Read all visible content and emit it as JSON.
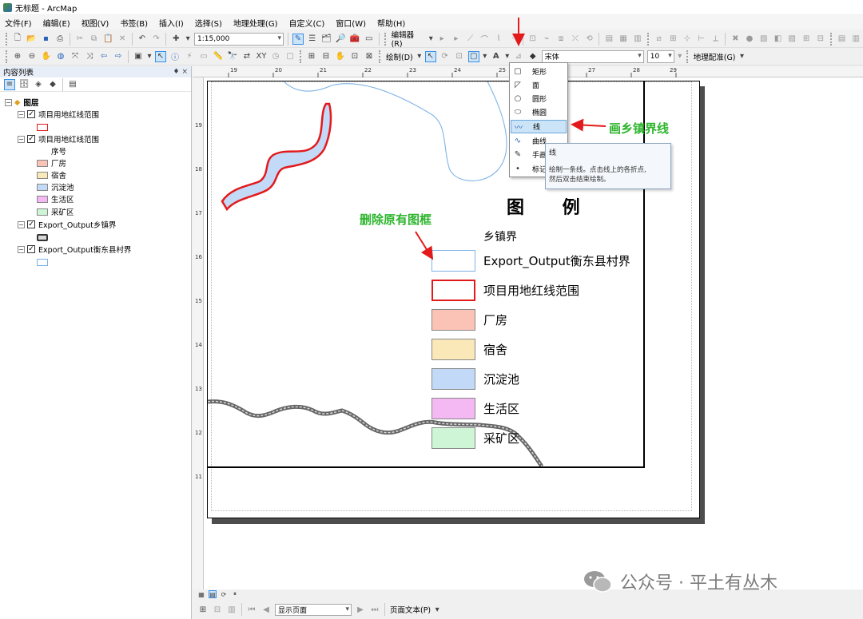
{
  "window": {
    "title": "无标题 - ArcMap"
  },
  "menu": [
    "文件(F)",
    "编辑(E)",
    "视图(V)",
    "书签(B)",
    "插入(I)",
    "选择(S)",
    "地理处理(G)",
    "自定义(C)",
    "窗口(W)",
    "帮助(H)"
  ],
  "toolbar1": {
    "scale": "1:15,000",
    "editor": "编辑器(R)"
  },
  "toolbar2": {
    "draw": "绘制(D)",
    "font": "宋体",
    "font_size": "10",
    "georef": "地理配准(G)"
  },
  "toc": {
    "title": "内容列表",
    "pin": "♦ ×",
    "root": "图层",
    "layers": [
      {
        "name": "项目用地红线范围"
      },
      {
        "name": "项目用地红线范围",
        "field": "序号",
        "classes": [
          "厂房",
          "宿舍",
          "沉淀池",
          "生活区",
          "采矿区"
        ]
      },
      {
        "name": "Export_Output乡镇界"
      },
      {
        "name": "Export_Output衡东县村界"
      }
    ]
  },
  "ruler": {
    "h": [
      "19",
      "20",
      "21",
      "22",
      "23",
      "24",
      "25",
      "26",
      "27",
      "28",
      "29"
    ],
    "v": [
      "19",
      "18",
      "17",
      "16",
      "15",
      "14",
      "13",
      "12",
      "11"
    ]
  },
  "legend": {
    "title": "图  例",
    "heading": "乡镇界",
    "items": [
      {
        "label": "Export_Output衡东县村界"
      },
      {
        "label": "项目用地红线范围"
      },
      {
        "label": "厂房"
      },
      {
        "label": "宿舍"
      },
      {
        "label": "沉淀池"
      },
      {
        "label": "生活区"
      },
      {
        "label": "采矿区"
      }
    ]
  },
  "dropdown": {
    "items": [
      "矩形",
      "面",
      "圆形",
      "椭圆",
      "线",
      "曲线",
      "手画",
      "标记"
    ],
    "highlighted": "线"
  },
  "tooltip": {
    "title": "线",
    "body_line1": "绘制一条线。点击线上的各折点,",
    "body_line2": "然后双击结束绘制。"
  },
  "annotations": {
    "draw_line": "画乡镇界线",
    "delete_frame": "删除原有图框"
  },
  "status": {
    "page_display": "显示页面",
    "page_text": "页面文本(P)"
  },
  "watermark": "公众号 · 平土有丛木",
  "colors": {
    "red_boundary": "#e31a1c",
    "river": "#7fb3e6",
    "factory": "#fbc2b6",
    "dorm": "#fbe8b8",
    "pond": "#c2daf7",
    "living": "#f4b8f3",
    "mining": "#cdf5d6",
    "annotation": "#2db52d"
  }
}
